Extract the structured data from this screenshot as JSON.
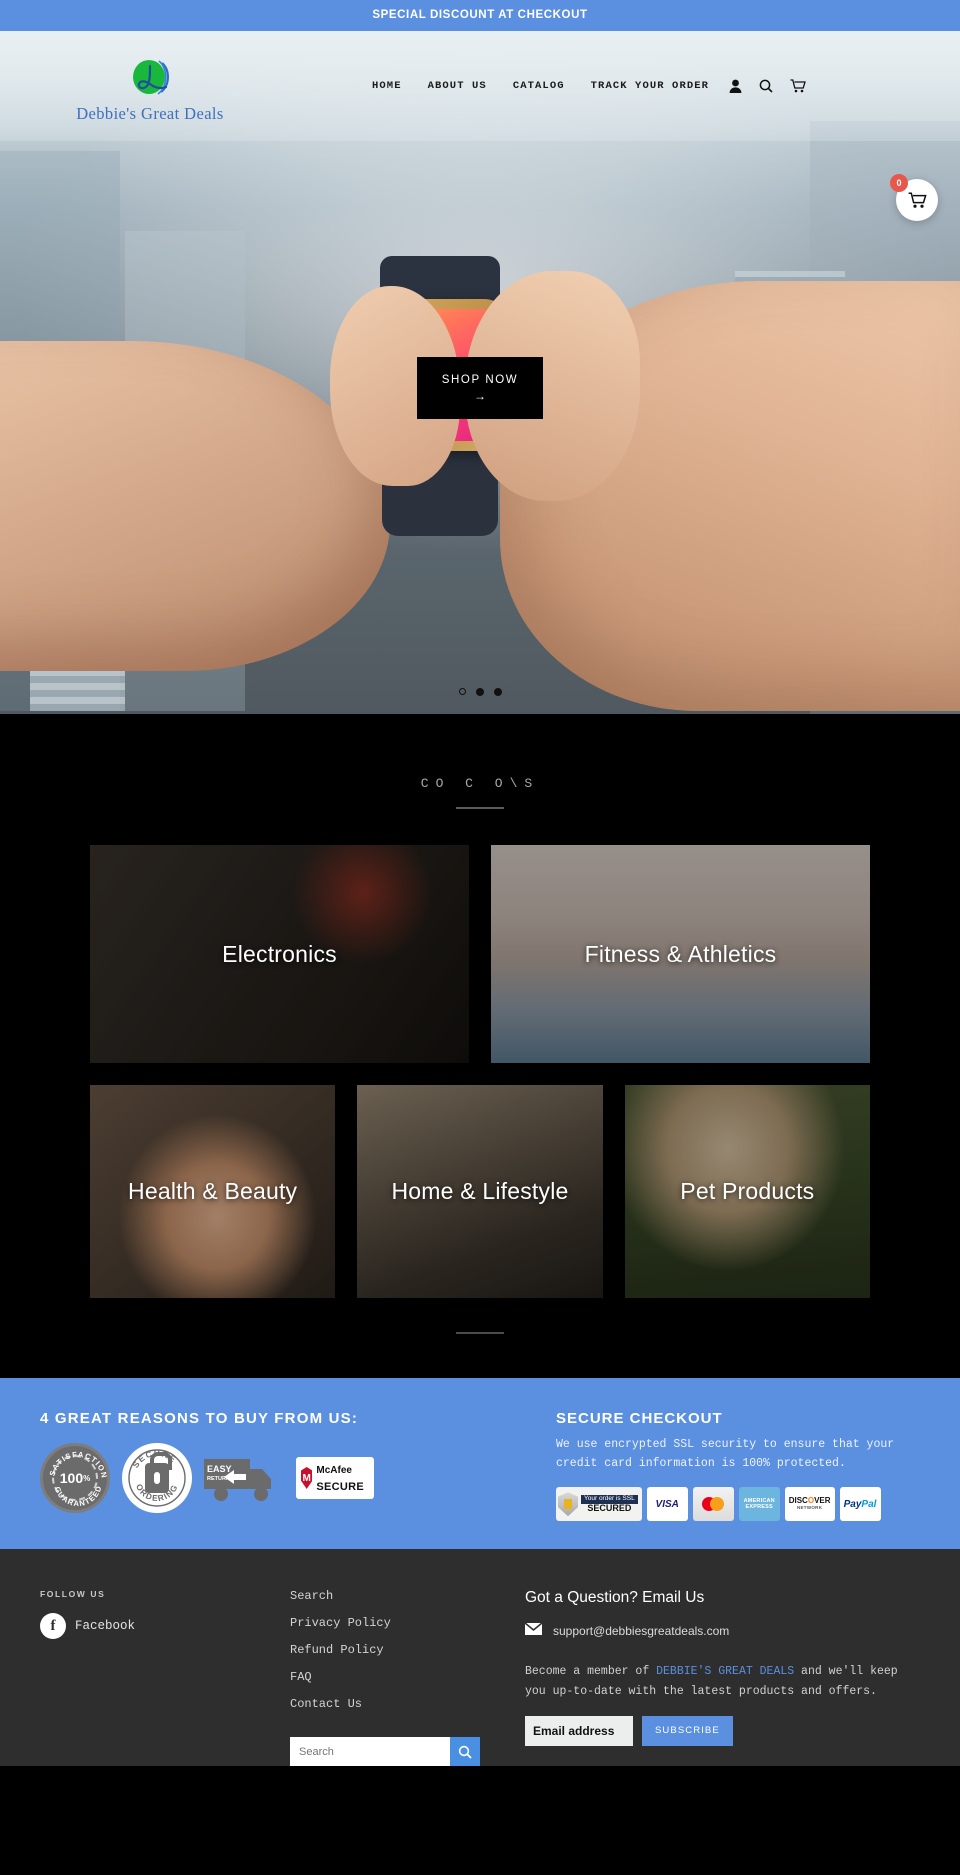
{
  "announcement": {
    "text": "SPECIAL DISCOUNT AT CHECKOUT"
  },
  "header": {
    "brand_name": "Debbie's Great Deals",
    "nav": [
      {
        "label": "HOME"
      },
      {
        "label": "ABOUT US"
      },
      {
        "label": "CATALOG"
      },
      {
        "label": "TRACK YOUR ORDER"
      }
    ],
    "icons": [
      {
        "name": "account-icon"
      },
      {
        "name": "search-icon"
      },
      {
        "name": "cart-icon"
      }
    ],
    "cart_count": "0"
  },
  "hero": {
    "cta_label": "SHOP NOW",
    "cta_arrow": "→",
    "slides": 3,
    "active_slide": 1
  },
  "collections": {
    "heading": "CO   C  O\\S",
    "tiles_row1": [
      {
        "label": "Electronics",
        "theme": "electronics"
      },
      {
        "label": "Fitness & Athletics",
        "theme": "fitness"
      }
    ],
    "tiles_row2": [
      {
        "label": "Health & Beauty",
        "theme": "health"
      },
      {
        "label": "Home & Lifestyle",
        "theme": "home"
      },
      {
        "label": "Pet Products",
        "theme": "pet"
      }
    ]
  },
  "trust": {
    "heading": "4 GREAT REASONS TO BUY FROM US:",
    "badges": [
      {
        "name": "satisfaction-guaranteed-badge",
        "top": "SATISFACTION",
        "value": "100",
        "unit": "%",
        "bottom": "GUARANTEED"
      },
      {
        "name": "secure-ordering-badge",
        "top": "SECURE",
        "bottom": "ORDERING"
      },
      {
        "name": "easy-returns-badge",
        "line1": "EASY",
        "line2": "RETURNS"
      },
      {
        "name": "mcafee-secure-badge",
        "line1": "McAfee",
        "line2": "SECURE",
        "mark": "M"
      }
    ],
    "checkout_heading": "SECURE CHECKOUT",
    "checkout_text": "We use encrypted SSL security to ensure that your credit card information is 100% protected.",
    "ssl_badge": {
      "top": "Your order is SSL",
      "bottom": "SECURED"
    },
    "payments": [
      {
        "name": "visa",
        "label": "VISA"
      },
      {
        "name": "mastercard",
        "label": "MasterCard"
      },
      {
        "name": "amex",
        "line1": "AMERICAN",
        "line2": "EXPRESS"
      },
      {
        "name": "discover",
        "line1": "DISC",
        "accent": "O",
        "line1b": "VER",
        "line2": "NETWORK"
      },
      {
        "name": "paypal",
        "label": "Pay",
        "accent": "Pal"
      }
    ]
  },
  "footer": {
    "follow_label": "FOLLOW US",
    "social": [
      {
        "label": "Facebook",
        "glyph": "f"
      }
    ],
    "links": [
      {
        "label": "Search"
      },
      {
        "label": "Privacy Policy"
      },
      {
        "label": "Refund Policy"
      },
      {
        "label": "FAQ"
      },
      {
        "label": "Contact Us"
      }
    ],
    "search_placeholder": "Search",
    "contact_heading": "Got a Question? Email Us",
    "email": "support@debbiesgreatdeals.com",
    "newsletter_pre": "Become a member of ",
    "newsletter_brand": "DEBBIE'S GREAT DEALS",
    "newsletter_post": " and we'll keep you up-to-date with the latest products and offers.",
    "email_value": "Email address",
    "subscribe_label": "SUBSCRIBE"
  },
  "colors": {
    "accent": "#5b8fe0",
    "dark": "#000000",
    "footer_bg": "#2e2e2e",
    "badge_red": "#e8574c"
  }
}
